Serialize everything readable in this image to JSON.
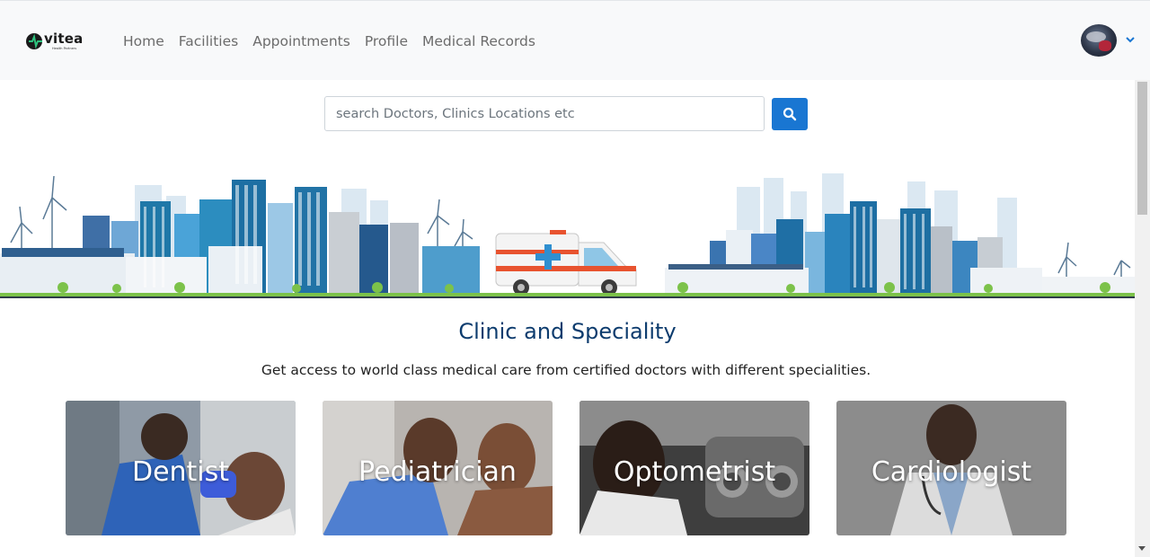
{
  "brand": {
    "name": "vitea",
    "tagline": "Health Partners"
  },
  "nav": {
    "items": [
      {
        "label": "Home"
      },
      {
        "label": "Facilities"
      },
      {
        "label": "Appointments"
      },
      {
        "label": "Profile"
      },
      {
        "label": "Medical Records"
      }
    ]
  },
  "user": {
    "avatar_icon": "avatar",
    "menu_icon": "chevron-down-icon"
  },
  "search": {
    "placeholder": "search Doctors, Clinics Locations etc",
    "button_icon": "search-icon"
  },
  "section": {
    "title": "Clinic and Speciality",
    "subtitle": "Get access to world class medical care from certified doctors with different specialities."
  },
  "specialities": [
    {
      "label": "Dentist"
    },
    {
      "label": "Pediatrician"
    },
    {
      "label": "Optometrist"
    },
    {
      "label": "Cardiologist"
    }
  ],
  "colors": {
    "accent": "#1976d2",
    "title": "#0d3c6e",
    "header_bg": "#f8f9fa"
  }
}
